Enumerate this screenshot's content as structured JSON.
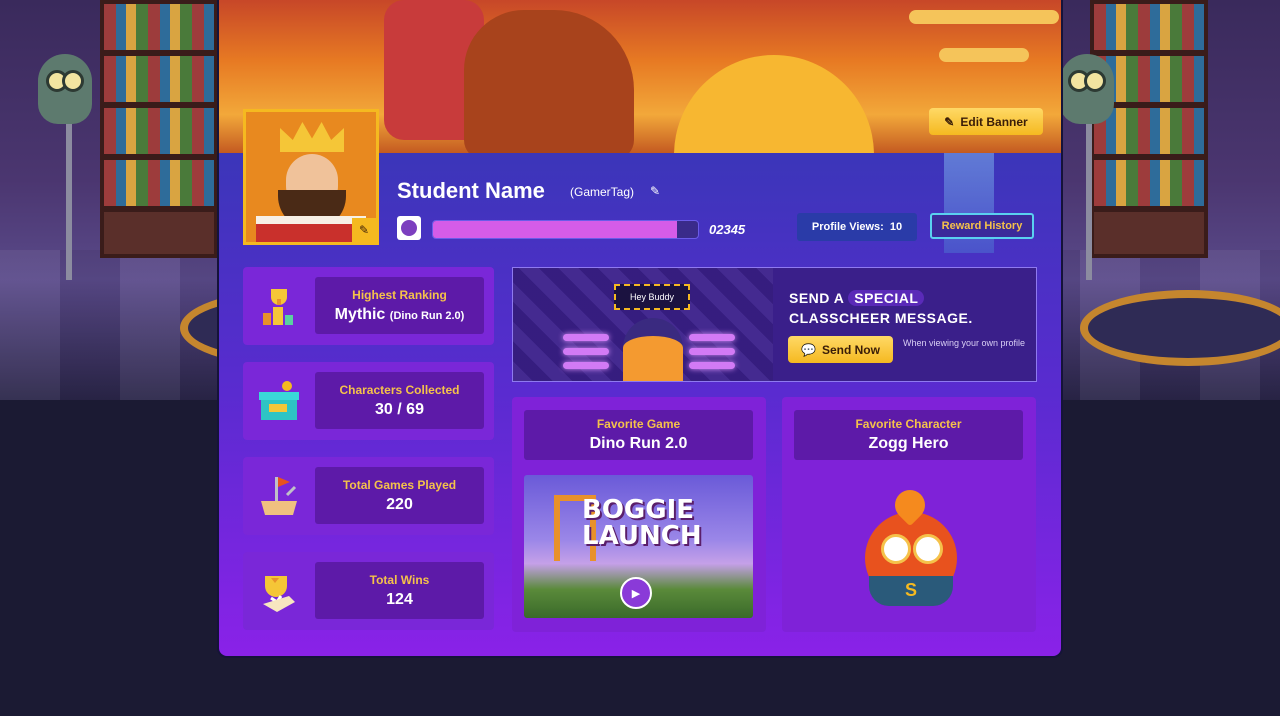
{
  "banner": {
    "edit_button_label": "Edit Banner",
    "colors": {
      "sky": "#e77a23",
      "accent_gold": "#f5b920"
    }
  },
  "profile": {
    "student_name": "Student Name",
    "gamertag": "(GamerTag)",
    "xp_value": "02345",
    "xp_fraction": 0.92,
    "profile_views_label": "Profile Views:",
    "profile_views_value": "10",
    "reward_history_label": "Reward History"
  },
  "stats": [
    {
      "label": "Highest Ranking",
      "value": "Mythic",
      "sub": "(Dino Run 2.0)",
      "icon": "trophy-icon"
    },
    {
      "label": "Characters Collected",
      "value": "30 / 69",
      "icon": "gift-box-icon"
    },
    {
      "label": "Total Games Played",
      "value": "220",
      "icon": "flag-sandcastle-icon"
    },
    {
      "label": "Total Wins",
      "value": "124",
      "icon": "winner-cup-icon"
    }
  ],
  "classcheer": {
    "bubble_text": "Hey Buddy",
    "title_line1_prefix": "SEND A",
    "title_line1_highlight": "SPECIAL",
    "title_line2": "CLASSCHEER MESSAGE.",
    "send_button_label": "Send Now",
    "note": "When viewing your own profile"
  },
  "favorite_game": {
    "label": "Favorite Game",
    "value": "Dino Run 2.0",
    "thumbnail_title_line1": "BOGGIE",
    "thumbnail_title_line2": "LAUNCH"
  },
  "favorite_character": {
    "label": "Favorite Character",
    "value": "Zogg Hero",
    "cape_letter": "S"
  }
}
